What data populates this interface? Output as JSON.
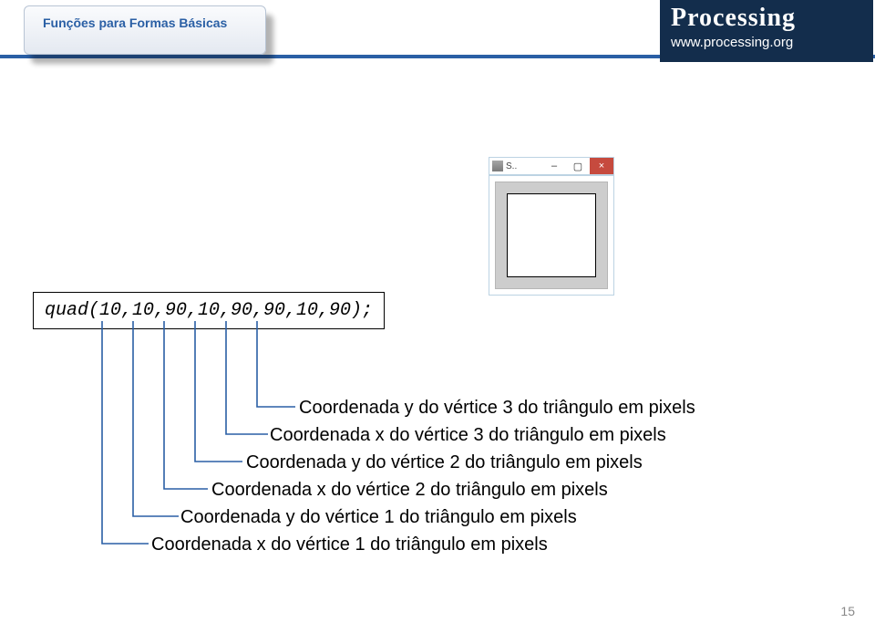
{
  "header": {
    "tab_title": "Funções para Formas Básicas",
    "logo_word": "Processing",
    "logo_url": "www.processing.org"
  },
  "window": {
    "title": "S..",
    "minimize": "–",
    "maximize": "▢",
    "close": "×"
  },
  "code": {
    "line": "quad(10,10,90,10,90,90,10,90);"
  },
  "labels": {
    "l1": "Coordenada y do vértice 3 do triângulo em pixels",
    "l2": "Coordenada x do vértice 3 do triângulo em pixels",
    "l3": "Coordenada y do vértice 2 do triângulo em pixels",
    "l4": "Coordenada x do vértice 2 do triângulo em pixels",
    "l5": "Coordenada y do vértice 1 do triângulo em pixels",
    "l6": "Coordenada x do vértice 1 do triângulo em pixels"
  },
  "page": {
    "number": "15"
  }
}
